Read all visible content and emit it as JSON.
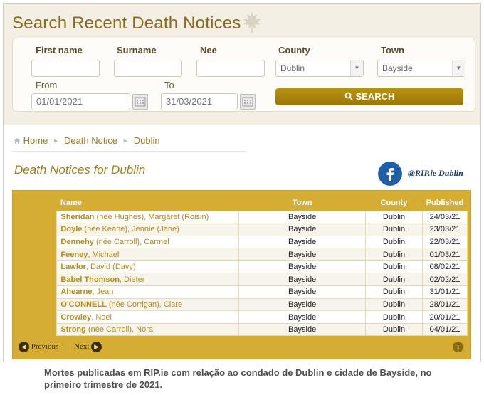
{
  "search": {
    "title": "Search Recent Death Notices",
    "labels": {
      "first_name": "First name",
      "surname": "Surname",
      "nee": "Nee",
      "county": "County",
      "town": "Town",
      "from": "From",
      "to": "To"
    },
    "values": {
      "first_name": "",
      "surname": "",
      "nee": "",
      "county": "Dublin",
      "town": "Bayside",
      "from": "01/01/2021",
      "to": "31/03/2021"
    },
    "button_label": "SEARCH"
  },
  "breadcrumb": {
    "home": "Home",
    "death_notice": "Death Notice",
    "dublin": "Dublin"
  },
  "section_title": "Death Notices for Dublin",
  "social": {
    "handle": "@RIP.ie Dublin"
  },
  "table": {
    "headers": {
      "name": "Name",
      "town": "Town",
      "county": "County",
      "published": "Published"
    },
    "rows": [
      {
        "surname": "Sheridan",
        "rest": " (née Hughes), Margaret (Roisin)",
        "town": "Bayside",
        "county": "Dublin",
        "published": "24/03/21"
      },
      {
        "surname": "Doyle",
        "rest": " (née Keane), Jennie (Jane)",
        "town": "Bayside",
        "county": "Dublin",
        "published": "23/03/21"
      },
      {
        "surname": "Dennehy",
        "rest": " (née Carroll), Carmel",
        "town": "Bayside",
        "county": "Dublin",
        "published": "22/03/21"
      },
      {
        "surname": "Feeney",
        "rest": ", Michael",
        "town": "Bayside",
        "county": "Dublin",
        "published": "01/03/21"
      },
      {
        "surname": "Lawlor",
        "rest": ", David (Davy)",
        "town": "Bayside",
        "county": "Dublin",
        "published": "08/02/21"
      },
      {
        "surname": "Babel Thomson",
        "rest": ", Dieter",
        "town": "Bayside",
        "county": "Dublin",
        "published": "02/02/21"
      },
      {
        "surname": "Ahearne",
        "rest": ", Jean",
        "town": "Bayside",
        "county": "Dublin",
        "published": "31/01/21"
      },
      {
        "surname": "O'CONNELL",
        "rest": " (née Corrigan), Clare",
        "town": "Bayside",
        "county": "Dublin",
        "published": "28/01/21"
      },
      {
        "surname": "Crowley",
        "rest": ", Noel",
        "town": "Bayside",
        "county": "Dublin",
        "published": "20/01/21"
      },
      {
        "surname": "Strong",
        "rest": " (née Carroll), Nora",
        "town": "Bayside",
        "county": "Dublin",
        "published": "04/01/21"
      }
    ]
  },
  "pager": {
    "previous": "Previous",
    "next": "Next"
  },
  "caption": "Mortes publicadas em RIP.ie com relação ao condado de Dublin e cidade de Bayside, no primeiro trimestre de 2021.",
  "colors": {
    "accent": "#a8820e",
    "header_bar": "#d6ad33",
    "link": "#b38b1a",
    "facebook": "#1f5fa8"
  }
}
